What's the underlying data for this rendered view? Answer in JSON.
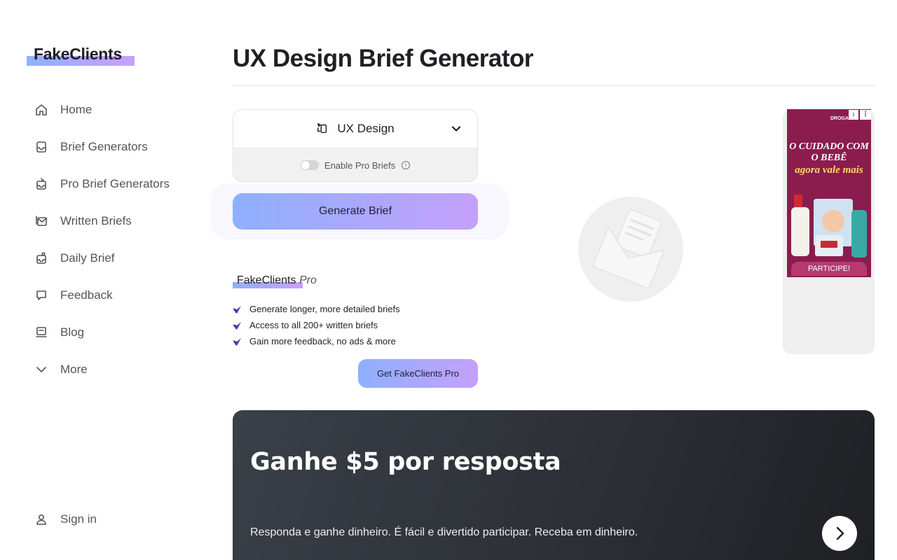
{
  "sidebar": {
    "logo": "FakeClients",
    "items": [
      {
        "label": "Home",
        "icon": "home-icon"
      },
      {
        "label": "Brief Generators",
        "icon": "inbox-icon"
      },
      {
        "label": "Pro Brief Generators",
        "icon": "pro-inbox-icon"
      },
      {
        "label": "Written Briefs",
        "icon": "mail-stack-icon"
      },
      {
        "label": "Daily Brief",
        "icon": "daily-inbox-icon"
      },
      {
        "label": "Feedback",
        "icon": "chat-icon"
      },
      {
        "label": "Blog",
        "icon": "blog-icon"
      },
      {
        "label": "More",
        "icon": "chevron-down-icon"
      }
    ],
    "signin": {
      "label": "Sign in",
      "icon": "user-icon"
    }
  },
  "main": {
    "title": "UX Design Brief Generator",
    "selector": {
      "value": "UX Design",
      "icon": "ux-design-icon"
    },
    "pro_toggle": {
      "label": "Enable Pro Briefs",
      "enabled": false
    },
    "generate_button": "Generate Brief"
  },
  "pro": {
    "brand": "FakeClients",
    "brand_suffix": "Pro",
    "features": [
      "Generate longer, more detailed briefs",
      "Access to all 200+ written briefs",
      "Gain more feedback, no ads & more"
    ],
    "cta": "Get FakeClients Pro"
  },
  "ad": {
    "brand": "DROGASIL",
    "headline": "O CUIDADO COM O BEBÊ",
    "subline": "agora vale mais",
    "cta": "PARTICIPE!",
    "info": "i",
    "more": "⋮"
  },
  "banner": {
    "title": "Ganhe $5 por resposta",
    "text": "Responda e ganhe dinheiro. É fácil e divertido participar. Receba em dinheiro."
  },
  "colors": {
    "accent_start": "#8fb0ff",
    "accent_end": "#c4a0fb",
    "banner_bg": "#2b2e34",
    "ad_bg": "#8a1d4e",
    "check": "#3a3fb0"
  }
}
